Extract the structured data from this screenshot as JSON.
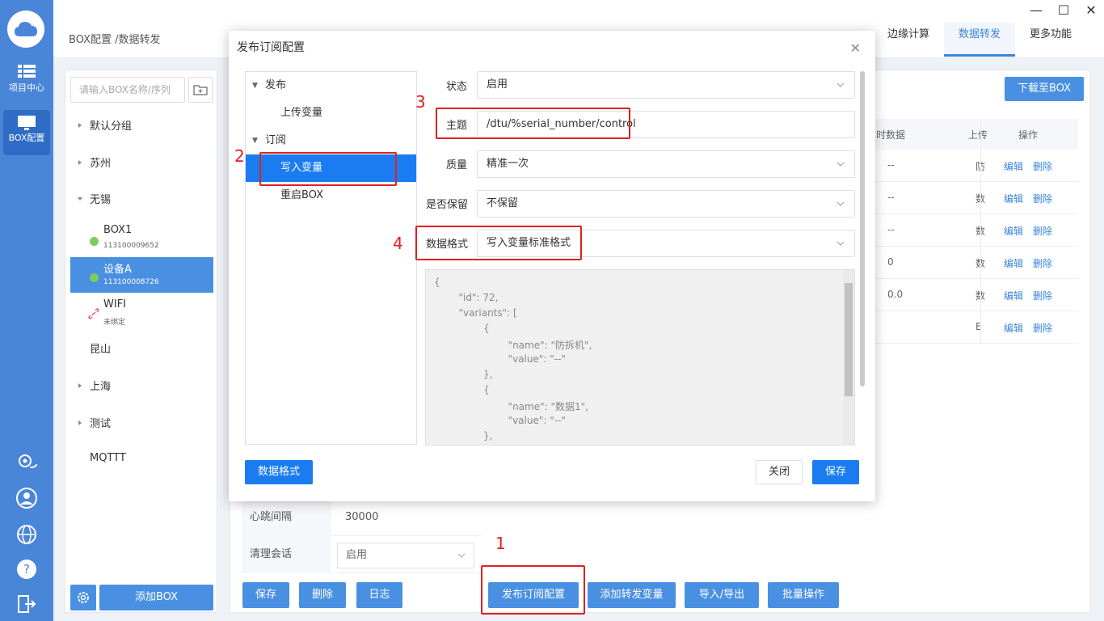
{
  "rail": {
    "items": [
      {
        "label": "项目中心"
      },
      {
        "label": "BOX配置"
      }
    ]
  },
  "window": {
    "breadcrumb": "BOX配置 /数据转发",
    "tabs": [
      "边缘计算",
      "数据转发",
      "更多功能"
    ]
  },
  "tree": {
    "search_placeholder": "请输入BOX名称/序列",
    "groups": [
      "默认分组",
      "苏州",
      "无锡",
      "昆山",
      "上海",
      "测试",
      "MQTTT"
    ],
    "devices": [
      {
        "name": "BOX1",
        "sn": "113100009652",
        "status_color": "#7ccc5e"
      },
      {
        "name": "设备A",
        "sn": "113100008726",
        "status_color": "#7ccc5e"
      },
      {
        "name": "WIFI",
        "sn": "未绑定"
      }
    ],
    "add_box": "添加BOX"
  },
  "background": {
    "download_button": "下载至BOX",
    "col_realtime": "实时数据",
    "col_upload": "上传",
    "col_ops": "操作",
    "rows": [
      {
        "realtime": "--",
        "upload": "防",
        "edit": "编辑",
        "del": "删除"
      },
      {
        "realtime": "--",
        "upload": "数",
        "edit": "编辑",
        "del": "删除"
      },
      {
        "realtime": "--",
        "upload": "数",
        "edit": "编辑",
        "del": "删除"
      },
      {
        "realtime": "0",
        "upload": "数",
        "edit": "编辑",
        "del": "删除"
      },
      {
        "realtime": "0.0",
        "upload": "数",
        "edit": "编辑",
        "del": "删除"
      },
      {
        "realtime": "",
        "upload": "E",
        "edit": "编辑",
        "del": "删除"
      }
    ],
    "heartbeat_label": "心跳间隔",
    "heartbeat_value": "30000",
    "clean_session_label": "清理会话",
    "clean_session_value": "启用",
    "buttons": {
      "save": "保存",
      "delete": "删除",
      "log": "日志",
      "publish_config": "发布订阅配置",
      "add_forward_var": "添加转发变量",
      "import_export": "导入/导出",
      "batch": "批量操作"
    }
  },
  "modal": {
    "title": "发布订阅配置",
    "tree": {
      "publish": "发布",
      "upload_var": "上传变量",
      "subscribe": "订阅",
      "write_var": "写入变量",
      "restart_box": "重启BOX"
    },
    "form": {
      "status_label": "状态",
      "status_value": "启用",
      "topic_label": "主题",
      "topic_value": "/dtu/%serial_number/control",
      "qos_label": "质量",
      "qos_value": "精准一次",
      "retain_label": "是否保留",
      "retain_value": "不保留",
      "format_label": "数据格式",
      "format_value": "写入变量标准格式"
    },
    "json_lines": [
      "{",
      "        \"id\": 72,",
      "        \"variants\": [",
      "                {",
      "                        \"name\": \"防拆机\",",
      "                        \"value\": \"--\"",
      "                },",
      "                {",
      "                        \"name\": \"数据1\",",
      "                        \"value\": \"--\"",
      "                },"
    ],
    "format_button": "数据格式",
    "close_button": "关闭",
    "save_button": "保存"
  },
  "annotations": [
    "1",
    "2",
    "3",
    "4"
  ],
  "colors": {
    "accent": "#4a90e2",
    "selected": "#1a7cf0",
    "annotation": "#e02020"
  }
}
